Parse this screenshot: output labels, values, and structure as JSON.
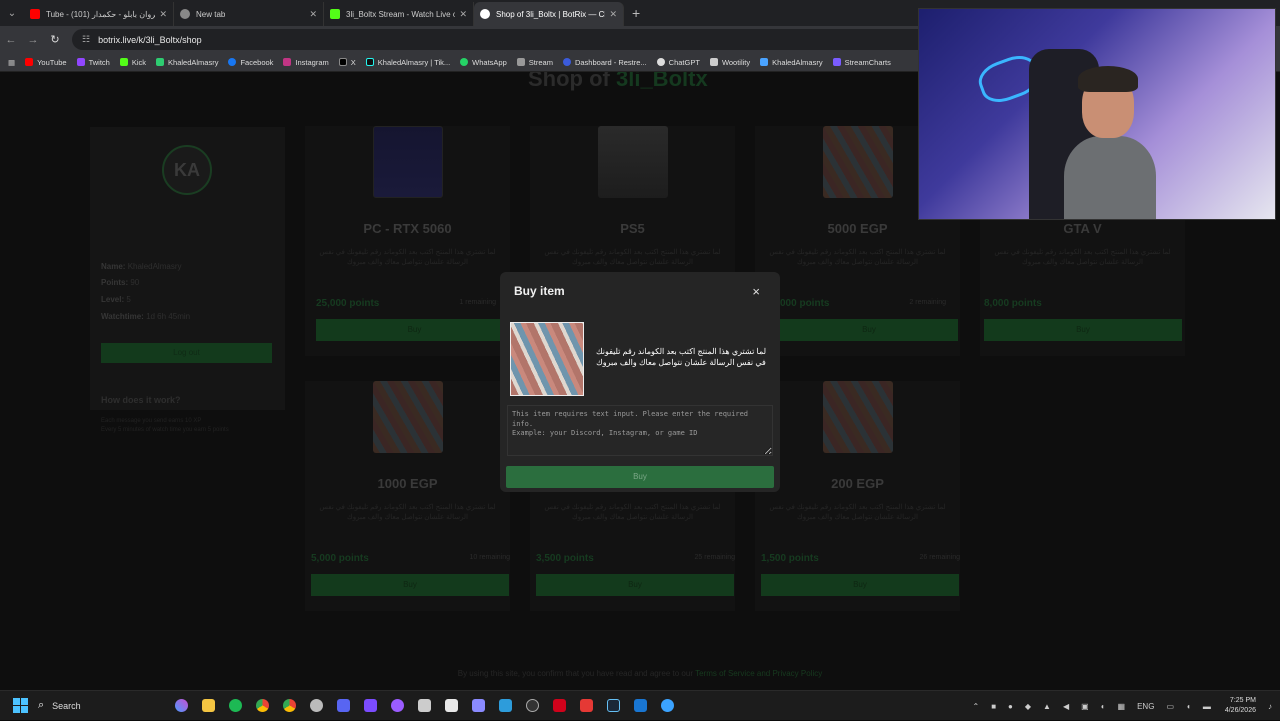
{
  "browser": {
    "tabs": [
      {
        "title": "(101) مروان بابلو - حكمدار - YouTube",
        "short": "Tube - (101) مروان بابلو - حكمدار",
        "color": "#ff0000"
      },
      {
        "title": "New tab",
        "short": "New tab",
        "color": "#888888"
      },
      {
        "title": "3li_Boltx Stream - Watch Live o...",
        "short": "3li_Boltx Stream - Watch Live o",
        "color": "#53fc18"
      },
      {
        "title": "Shop of 3li_Boltx | BotRix — Cli...",
        "short": "Shop of 3li_Boltx | BotRix — Cli",
        "color": "#ffffff"
      }
    ],
    "url": "botrix.live/k/3li_Boltx/shop",
    "bookmarks": [
      "YouTube",
      "Twitch",
      "Kick",
      "KhaledAlmasry",
      "Facebook",
      "Instagram",
      "X",
      "KhaledAlmasry | Tik...",
      "WhatsApp",
      "Stream",
      "Dashboard - Restre...",
      "ChatGPT",
      "Wootility",
      "KhaledAlmasry",
      "StreamCharts"
    ]
  },
  "shop": {
    "title_prefix": "Shop of ",
    "title_name": "3li_Boltx",
    "profile": {
      "avatar_text": "KA",
      "name_label": "Name:",
      "name": "KhaledAlmasry",
      "points_label": "Points:",
      "points": "90",
      "level_label": "Level:",
      "level": "5",
      "watch_label": "Watchtime:",
      "watchtime": "1d 6h 45min",
      "logout": "Log out",
      "how_title": "How does it work?",
      "how_text_1": "Each message you send earns 10 XP",
      "how_text_2": "Every 5 minutes of watch time you earn 5 points"
    },
    "desc": "لما تشتري هذا المنتج اكتب بعد الكوماند رقم تليفونك في نفس الرسالة علشان نتواصل معاك والف مبروك",
    "buy_label": "Buy",
    "items": [
      {
        "name": "PC - RTX 5060",
        "points": "25,000 points",
        "remaining": "1 remaining",
        "img": "pc"
      },
      {
        "name": "PS5",
        "points": "",
        "remaining": "",
        "img": "ps"
      },
      {
        "name": "5000 EGP",
        "points": "000 points",
        "remaining": "2 remaining",
        "img": "money"
      },
      {
        "name": "GTA V",
        "points": "8,000 points",
        "remaining": "",
        "img": "money"
      },
      {
        "name": "1000 EGP",
        "points": "5,000 points",
        "remaining": "10 remaining",
        "img": "money"
      },
      {
        "name": "",
        "points": "3,500 points",
        "remaining": "25 remaining",
        "img": "money"
      },
      {
        "name": "200 EGP",
        "points": "1,500 points",
        "remaining": "26 remaining",
        "img": "money"
      }
    ],
    "footer_text": "By using this site, you confirm that you have read and agree to our ",
    "footer_link": "Terms of Service and Privacy Policy"
  },
  "modal": {
    "title": "Buy item",
    "close": "×",
    "description": "لما تشتري هذا المنتج اكتب بعد الكوماند رقم تليفونك في نفس الرسالة علشان نتواصل معاك والف مبروك",
    "placeholder": "This item requires text input. Please enter the required info.\nExample: your Discord, Instagram, or game ID",
    "buy_button": "Buy"
  },
  "taskbar": {
    "search": "Search",
    "lang": "ENG",
    "time": "7:25 PM",
    "date": "4/26/2026"
  }
}
